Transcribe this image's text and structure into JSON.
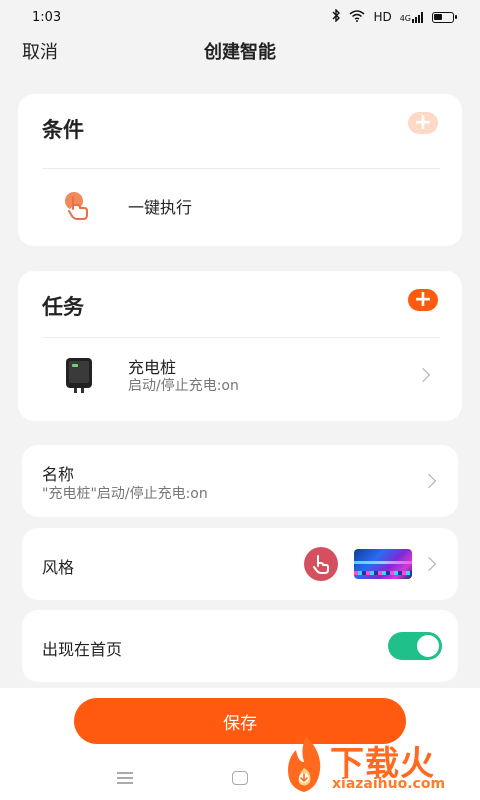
{
  "status_bar": {
    "time": "1:03",
    "hd": "HD",
    "network": "4G"
  },
  "header": {
    "cancel_label": "取消",
    "title": "创建智能"
  },
  "conditions": {
    "title": "条件",
    "items": [
      {
        "label": "一键执行",
        "icon": "tap-hand-icon"
      }
    ]
  },
  "tasks": {
    "title": "任务",
    "items": [
      {
        "label": "充电桩",
        "sub": "启动/停止充电:on",
        "icon": "charger-icon"
      }
    ]
  },
  "name_row": {
    "label": "名称",
    "value": "\"充电桩\"启动/停止充电:on"
  },
  "style_row": {
    "label": "风格"
  },
  "homepage_row": {
    "label": "出现在首页",
    "enabled": true
  },
  "save_label": "保存",
  "watermark": {
    "brand": "下载火",
    "domain": "xiazaihuo.com"
  },
  "colors": {
    "accent": "#ff5a0f",
    "toggle_on": "#1fc08a",
    "add_disabled": "#ffd9c7"
  }
}
